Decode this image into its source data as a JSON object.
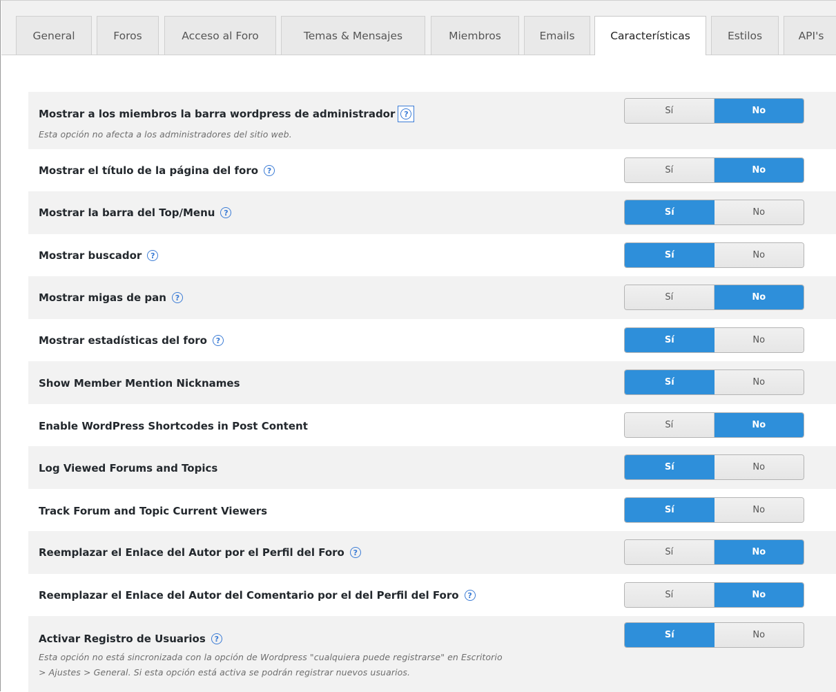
{
  "tabs": [
    {
      "label": "General",
      "active": false
    },
    {
      "label": "Foros",
      "active": false
    },
    {
      "label": "Acceso al Foro",
      "active": false
    },
    {
      "label": "Temas & Mensajes",
      "active": false
    },
    {
      "label": "Miembros",
      "active": false
    },
    {
      "label": "Emails",
      "active": false
    },
    {
      "label": "Características",
      "active": true
    },
    {
      "label": "Estilos",
      "active": false
    },
    {
      "label": "API's",
      "active": false
    }
  ],
  "options": {
    "yes_label": "Sí",
    "no_label": "No"
  },
  "settings": [
    {
      "label": "Mostrar a los miembros la barra wordpress de administrador",
      "description": "Esta opción no afecta a los administradores del sitio web.",
      "help": true,
      "value": "No"
    },
    {
      "label": "Mostrar el título de la página del foro",
      "help": true,
      "value": "No"
    },
    {
      "label": "Mostrar la barra del Top/Menu",
      "help": true,
      "value": "Sí"
    },
    {
      "label": "Mostrar buscador",
      "help": true,
      "value": "Sí"
    },
    {
      "label": "Mostrar migas de pan",
      "help": true,
      "value": "No"
    },
    {
      "label": "Mostrar estadísticas del foro",
      "help": true,
      "value": "Sí"
    },
    {
      "label": "Show Member Mention Nicknames",
      "help": false,
      "value": "Sí"
    },
    {
      "label": "Enable WordPress Shortcodes in Post Content",
      "help": false,
      "value": "No"
    },
    {
      "label": "Log Viewed Forums and Topics",
      "help": false,
      "value": "Sí"
    },
    {
      "label": "Track Forum and Topic Current Viewers",
      "help": false,
      "value": "Sí"
    },
    {
      "label": "Reemplazar el Enlace del Autor por el Perfil del Foro",
      "help": true,
      "value": "No"
    },
    {
      "label": "Reemplazar el Enlace del Autor del Comentario por el del Perfil del Foro",
      "help": true,
      "value": "No"
    },
    {
      "label": "Activar Registro de Usuarios",
      "description": "Esta opción no está sincronizada con la opción de Wordpress \"cualquiera puede registrarse\" en Escritorio",
      "description2": "> Ajustes > General. Si esta opción está activa se podrán registrar nuevos usuarios.",
      "help": true,
      "value": "Sí"
    }
  ],
  "colors": {
    "accent": "#2e8fda",
    "help_icon": "#3a7bd5",
    "row_shade": "#f2f2f2"
  }
}
